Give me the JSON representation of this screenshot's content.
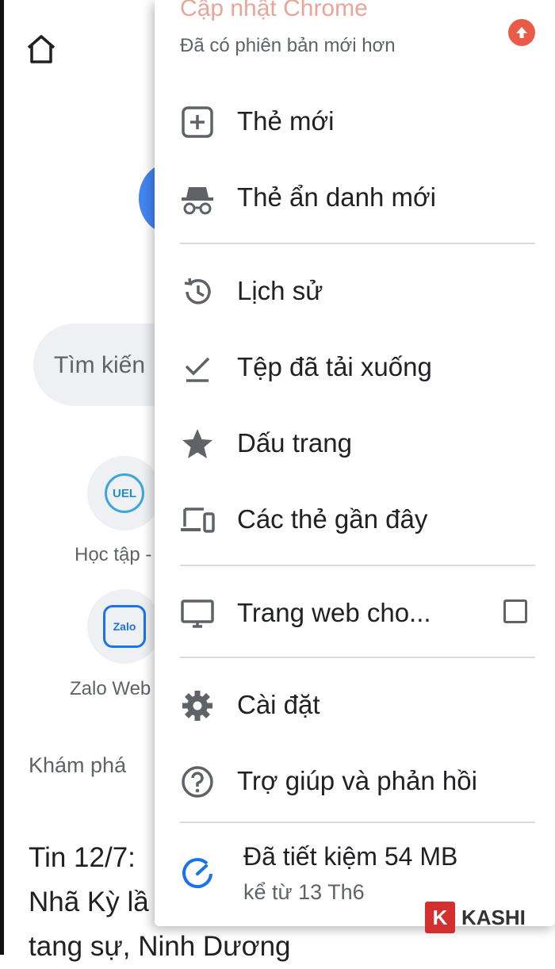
{
  "background": {
    "search_text": "Tìm kiến",
    "tiles": [
      {
        "label": "Học tập -",
        "logo_text": "UEL"
      },
      {
        "label": "Zalo Web",
        "logo_text": "Zalo"
      }
    ],
    "discover_label": "Khám phá",
    "news_lines": [
      "Tin 12/7:",
      "Nhã Kỳ lầ",
      "tang sự, Ninh Dương"
    ]
  },
  "menu": {
    "update": {
      "title": "Cập nhật Chrome",
      "subtitle": "Đã có phiên bản mới hơn"
    },
    "items": [
      {
        "label": "Thẻ mới",
        "icon": "new-tab-icon"
      },
      {
        "label": "Thẻ ẩn danh mới",
        "icon": "incognito-icon"
      },
      {
        "label": "Lịch sử",
        "icon": "history-icon"
      },
      {
        "label": "Tệp đã tải xuống",
        "icon": "downloads-icon"
      },
      {
        "label": "Dấu trang",
        "icon": "star-icon"
      },
      {
        "label": "Các thẻ gần đây",
        "icon": "devices-icon"
      },
      {
        "label": "Trang web cho...",
        "icon": "desktop-icon",
        "checked": false
      },
      {
        "label": "Cài đặt",
        "icon": "gear-icon"
      },
      {
        "label": "Trợ giúp và phản hồi",
        "icon": "help-icon"
      }
    ],
    "saved": {
      "title": "Đã tiết kiệm 54 MB",
      "subtitle": "kể từ 13 Th6"
    }
  },
  "watermark": {
    "letter": "K",
    "text": "KASHI"
  },
  "colors": {
    "accent": "#4285f4",
    "icon_gray": "#5f6368",
    "update_red": "#ea5a47"
  }
}
